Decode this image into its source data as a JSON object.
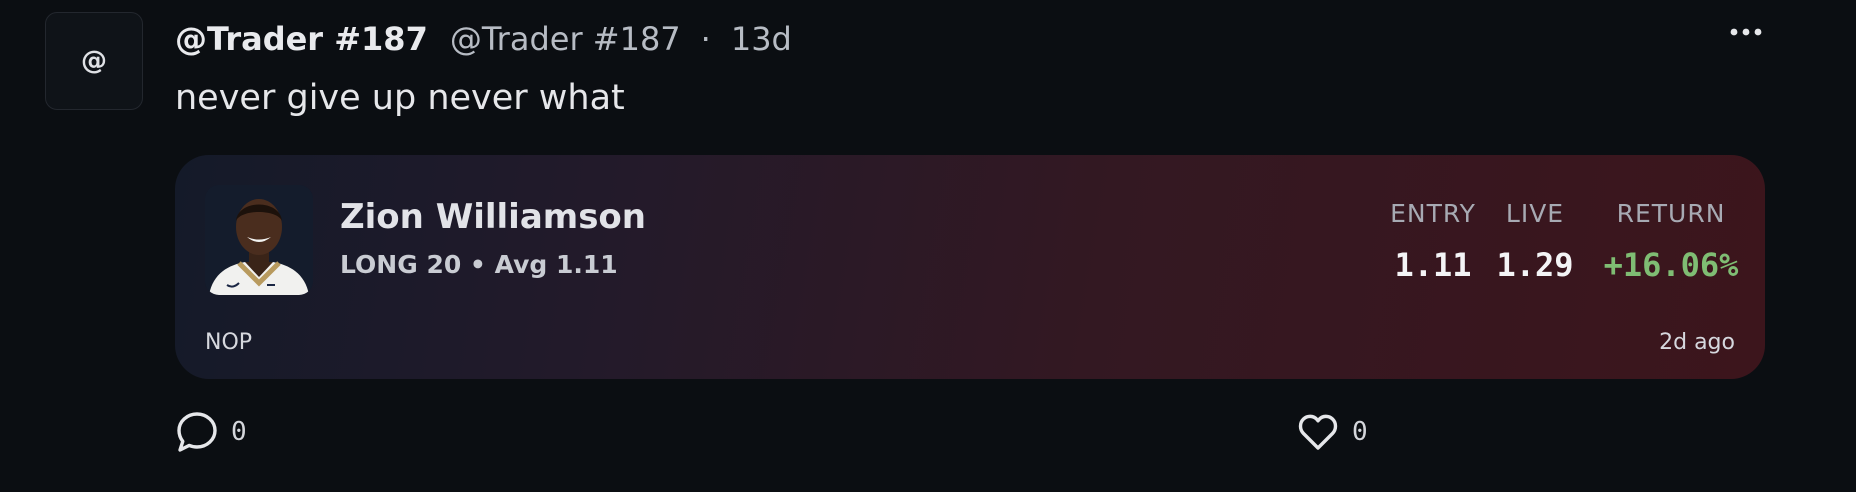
{
  "post": {
    "avatar_text": "@",
    "display_name": "@Trader #187",
    "handle": "@Trader #187",
    "separator": "·",
    "time_ago": "13d",
    "more_icon": "more-horizontal-icon",
    "text": "never give up never what"
  },
  "card": {
    "player_name": "Zion Williamson",
    "position_line": "LONG 20 • Avg 1.11",
    "team": "NOP",
    "time_ago": "2d ago",
    "stats": {
      "entry_label": "ENTRY",
      "entry_value": "1.11",
      "live_label": "LIVE",
      "live_value": "1.29",
      "return_label": "RETURN",
      "return_value": "+16.06%"
    },
    "colors": {
      "return_positive": "#7fbd73",
      "gradient_start": "#141a29",
      "gradient_end": "#3c151c"
    }
  },
  "actions": {
    "comment_icon": "comment-icon",
    "comment_count": "0",
    "like_icon": "heart-icon",
    "like_count": "0"
  }
}
